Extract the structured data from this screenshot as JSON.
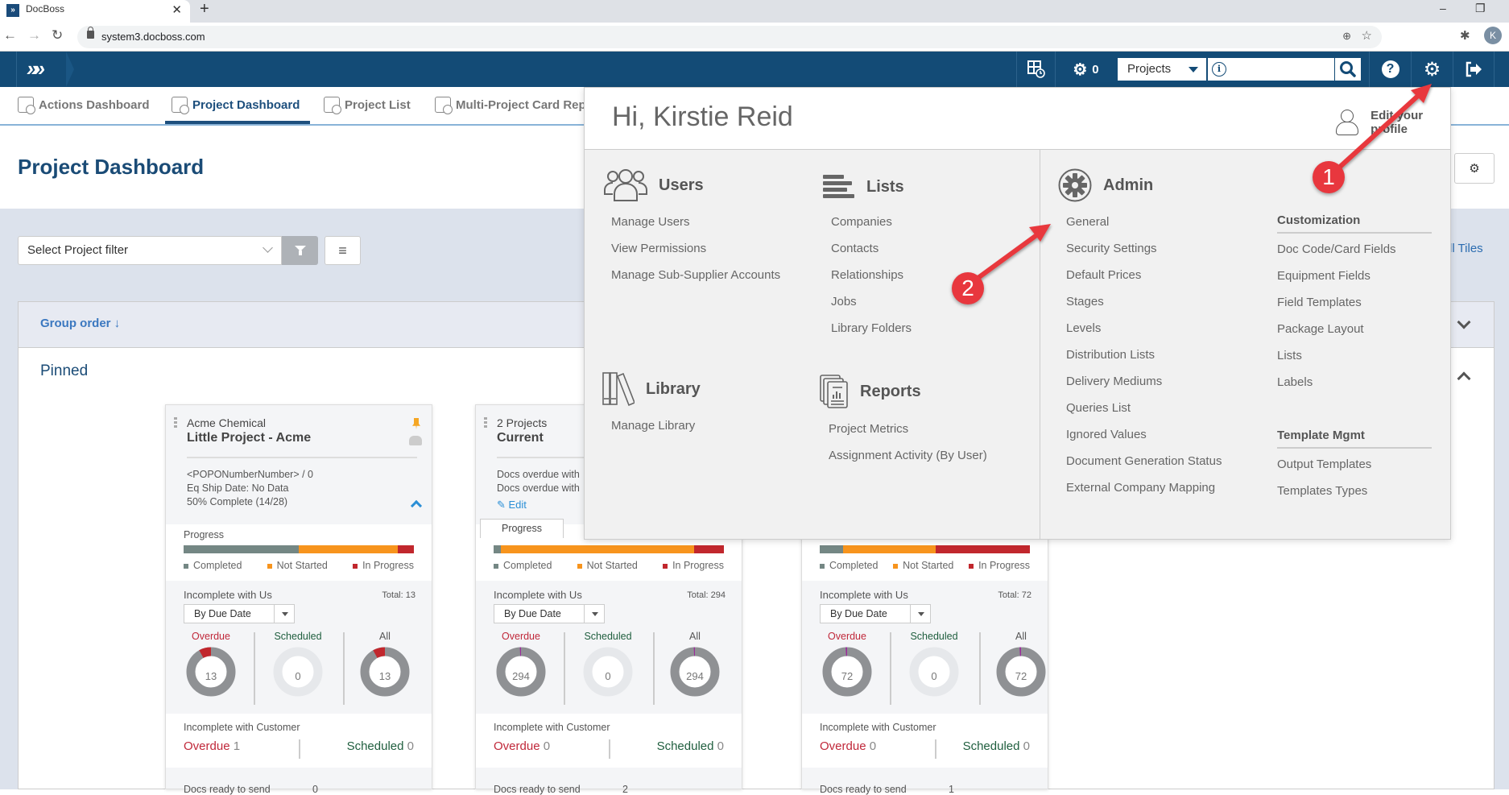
{
  "browser": {
    "tab_title": "DocBoss",
    "url": "system3.docboss.com",
    "profile_initial": "K"
  },
  "header": {
    "notifications_count": "0",
    "search_scope": "Projects",
    "search_placeholder": ""
  },
  "nav_tabs": [
    {
      "label": "Actions Dashboard"
    },
    {
      "label": "Project Dashboard"
    },
    {
      "label": "Project List"
    },
    {
      "label": "Multi-Project Card Rep"
    }
  ],
  "page": {
    "title": "Project Dashboard",
    "filter_placeholder": "Select Project filter",
    "tiles_link": "ll Tiles",
    "group_order": "Group order ↓",
    "pinned_label": "Pinned"
  },
  "cards": [
    {
      "company": "Acme Chemical",
      "name": "Little Project - Acme",
      "meta": [
        "<POPONumberNumber> / 0",
        "Eq Ship Date: No Data",
        "50% Complete (14/28)"
      ],
      "progress_label": "Progress",
      "progress": {
        "completed": 50,
        "not_started": 43,
        "in_progress": 7
      },
      "legend": [
        "Completed",
        "Not Started",
        "In Progress"
      ],
      "incomplete_us_label": "Incomplete with Us",
      "total_label": "Total:",
      "total": "13",
      "sort": "By Due Date",
      "overdue_label": "Overdue",
      "overdue": "13",
      "overdue_frac": 0.08,
      "scheduled_label": "Scheduled",
      "scheduled": "0",
      "all_label": "All",
      "all": "13",
      "all_frac": 0.08,
      "incomplete_cust_label": "Incomplete with Customer",
      "cust_overdue": "1",
      "cust_scheduled": "0",
      "docs_ready_label": "Docs ready to send",
      "docs_ready": "0"
    },
    {
      "company": "2 Projects",
      "name": "Current",
      "meta": [
        "Docs overdue with",
        "Docs overdue with"
      ],
      "edit_label": "Edit",
      "progress_label": "Progress",
      "progress": {
        "completed": 3,
        "not_started": 84,
        "in_progress": 13
      },
      "legend": [
        "Completed",
        "Not Started",
        "In Progress"
      ],
      "incomplete_us_label": "Incomplete with Us",
      "total_label": "Total:",
      "total": "294",
      "sort": "By Due Date",
      "overdue_label": "Overdue",
      "overdue": "294",
      "overdue_frac": 0.005,
      "scheduled_label": "Scheduled",
      "scheduled": "0",
      "all_label": "All",
      "all": "294",
      "all_frac": 0.005,
      "incomplete_cust_label": "Incomplete with Customer",
      "cust_overdue": "0",
      "cust_scheduled": "0",
      "docs_ready_label": "Docs ready to send",
      "docs_ready": "2"
    },
    {
      "progress": {
        "completed": 11,
        "not_started": 44,
        "in_progress": 45
      },
      "legend": [
        "Completed",
        "Not Started",
        "In Progress"
      ],
      "incomplete_us_label": "Incomplete with Us",
      "total_label": "Total:",
      "total": "72",
      "sort": "By Due Date",
      "overdue_label": "Overdue",
      "overdue": "72",
      "overdue_frac": 0.01,
      "scheduled_label": "Scheduled",
      "scheduled": "0",
      "all_label": "All",
      "all": "72",
      "all_frac": 0.01,
      "incomplete_cust_label": "Incomplete with Customer",
      "cust_overdue": "0",
      "cust_scheduled": "0",
      "docs_ready_label": "Docs ready to send",
      "docs_ready": "1"
    }
  ],
  "menu": {
    "greeting": "Hi, Kirstie Reid",
    "edit_profile": "Edit your profile",
    "users": {
      "title": "Users",
      "items": [
        "Manage Users",
        "View Permissions",
        "Manage Sub-Supplier Accounts"
      ]
    },
    "lists": {
      "title": "Lists",
      "items": [
        "Companies",
        "Contacts",
        "Relationships",
        "Jobs",
        "Library Folders"
      ]
    },
    "library": {
      "title": "Library",
      "items": [
        "Manage Library"
      ]
    },
    "reports": {
      "title": "Reports",
      "items": [
        "Project Metrics",
        "Assignment Activity (By User)"
      ]
    },
    "admin": {
      "title": "Admin",
      "items": [
        "General",
        "Security Settings",
        "Default Prices",
        "Stages",
        "Levels",
        "Distribution Lists",
        "Delivery Mediums",
        "Queries List",
        "Ignored Values",
        "Document Generation Status",
        "External Company Mapping"
      ]
    },
    "customization": {
      "title": "Customization",
      "items": [
        "Doc Code/Card Fields",
        "Equipment Fields",
        "Field Templates",
        "Package Layout",
        "Lists",
        "Labels"
      ]
    },
    "template_mgmt": {
      "title": "Template Mgmt",
      "items": [
        "Output Templates",
        "Templates Types"
      ]
    }
  },
  "annotations": [
    {
      "label": "1"
    },
    {
      "label": "2"
    }
  ],
  "colors": {
    "brand": "#134b76",
    "completed": "#748784",
    "not_started": "#f7941d",
    "in_progress": "#c1272d",
    "overdue": "#c0283a",
    "scheduled": "#1f5e3e",
    "annotation": "#e8373e"
  }
}
